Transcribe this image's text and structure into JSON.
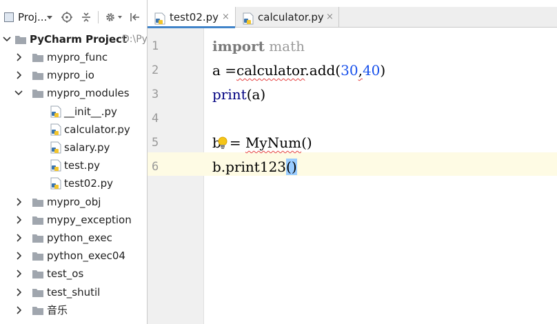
{
  "project_panel": {
    "dropdown_label": "Proj...",
    "dropdown_arrow_icon": "triangle-down-icon",
    "toolbar_icons": [
      "crosshair-locate-icon",
      "collapse-all-icon",
      "gear-icon",
      "hide-panel-icon"
    ],
    "root": {
      "name": "PyCharm Project",
      "path": "D:\\Py"
    },
    "items": [
      {
        "label": "mypro_func",
        "type": "folder",
        "expanded": false
      },
      {
        "label": "mypro_io",
        "type": "folder",
        "expanded": false
      },
      {
        "label": "mypro_modules",
        "type": "folder",
        "expanded": true
      },
      {
        "label": "__init__.py",
        "type": "py-file"
      },
      {
        "label": "calculator.py",
        "type": "py-file"
      },
      {
        "label": "salary.py",
        "type": "py-file"
      },
      {
        "label": "test.py",
        "type": "py-file"
      },
      {
        "label": "test02.py",
        "type": "py-file"
      },
      {
        "label": "mypro_obj",
        "type": "folder",
        "expanded": false
      },
      {
        "label": "mypy_exception",
        "type": "folder",
        "expanded": false
      },
      {
        "label": "python_exec",
        "type": "folder",
        "expanded": false
      },
      {
        "label": "python_exec04",
        "type": "folder",
        "expanded": false
      },
      {
        "label": "test_os",
        "type": "folder",
        "expanded": false
      },
      {
        "label": "test_shutil",
        "type": "folder",
        "expanded": false
      },
      {
        "label": "音乐",
        "type": "folder",
        "expanded": false
      }
    ]
  },
  "editor": {
    "tabs": [
      {
        "label": "test02.py",
        "active": true,
        "close": "×"
      },
      {
        "label": "calculator.py",
        "active": false,
        "close": "×"
      }
    ],
    "line_numbers": [
      "1",
      "2",
      "3",
      "4",
      "5",
      "6"
    ],
    "code": {
      "l1": {
        "kw": "import",
        "module": " math"
      },
      "l2": {
        "a": "a =",
        "calc": "calculator",
        "call": ".add(",
        "n1": "30",
        "comma": ",",
        "n2": "40",
        "close": ")"
      },
      "l3": {
        "kw": "print",
        "rest": "(a)"
      },
      "l5": {
        "b": "b",
        "mid": "= ",
        "cls": "MyNum",
        "rest": "()"
      },
      "l6": {
        "pre": "b.print123",
        "brace": "()"
      }
    },
    "caret_line": 6,
    "intention_icon": "lightbulb-icon"
  },
  "colors": {
    "keyword": "#000080",
    "number": "#1750eb",
    "caret_line_bg": "#fefbe4",
    "gutter_bg": "#f0f0f0",
    "brace_highlight": "#99ccff",
    "tab_active_underline": "#4083c9",
    "error_squiggle": "#e53e3e"
  }
}
